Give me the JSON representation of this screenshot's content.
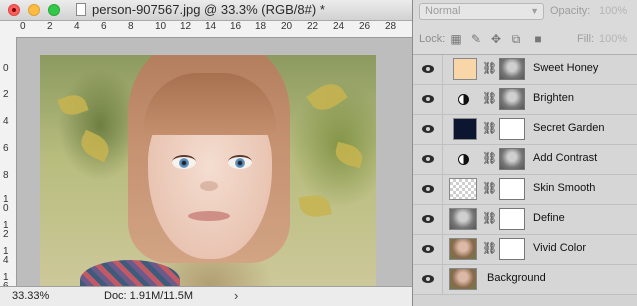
{
  "document": {
    "title": "person-907567.jpg @ 33.3% (RGB/8#) *",
    "ruler_top_ticks": [
      "0",
      "2",
      "4",
      "6",
      "8",
      "10",
      "12",
      "14",
      "16",
      "18",
      "20",
      "22",
      "24",
      "26",
      "28"
    ],
    "ruler_left_ticks": [
      "0",
      "2",
      "4",
      "6",
      "8",
      "1\n0",
      "1\n2",
      "1\n4",
      "1\n6"
    ],
    "status": {
      "zoom": "33.33%",
      "doc_size": "Doc: 1.91M/11.5M",
      "arrow": "›"
    }
  },
  "layers_panel": {
    "blend_mode": "Normal",
    "opacity_label": "Opacity:",
    "opacity_value": "100%",
    "lock_label": "Lock:",
    "fill_label": "Fill:",
    "fill_value": "100%",
    "layers": [
      {
        "name": "Sweet Honey",
        "type": "solid",
        "color": "#f8d6a8"
      },
      {
        "name": "Brighten",
        "type": "adjustment"
      },
      {
        "name": "Secret Garden",
        "type": "solid",
        "color": "#0d1630"
      },
      {
        "name": "Add Contrast",
        "type": "adjustment"
      },
      {
        "name": "Skin Smooth",
        "type": "pixel-transparent"
      },
      {
        "name": "Define",
        "type": "pixel-gray"
      },
      {
        "name": "Vivid Color",
        "type": "pixel-photo"
      },
      {
        "name": "Background",
        "type": "background"
      }
    ]
  }
}
